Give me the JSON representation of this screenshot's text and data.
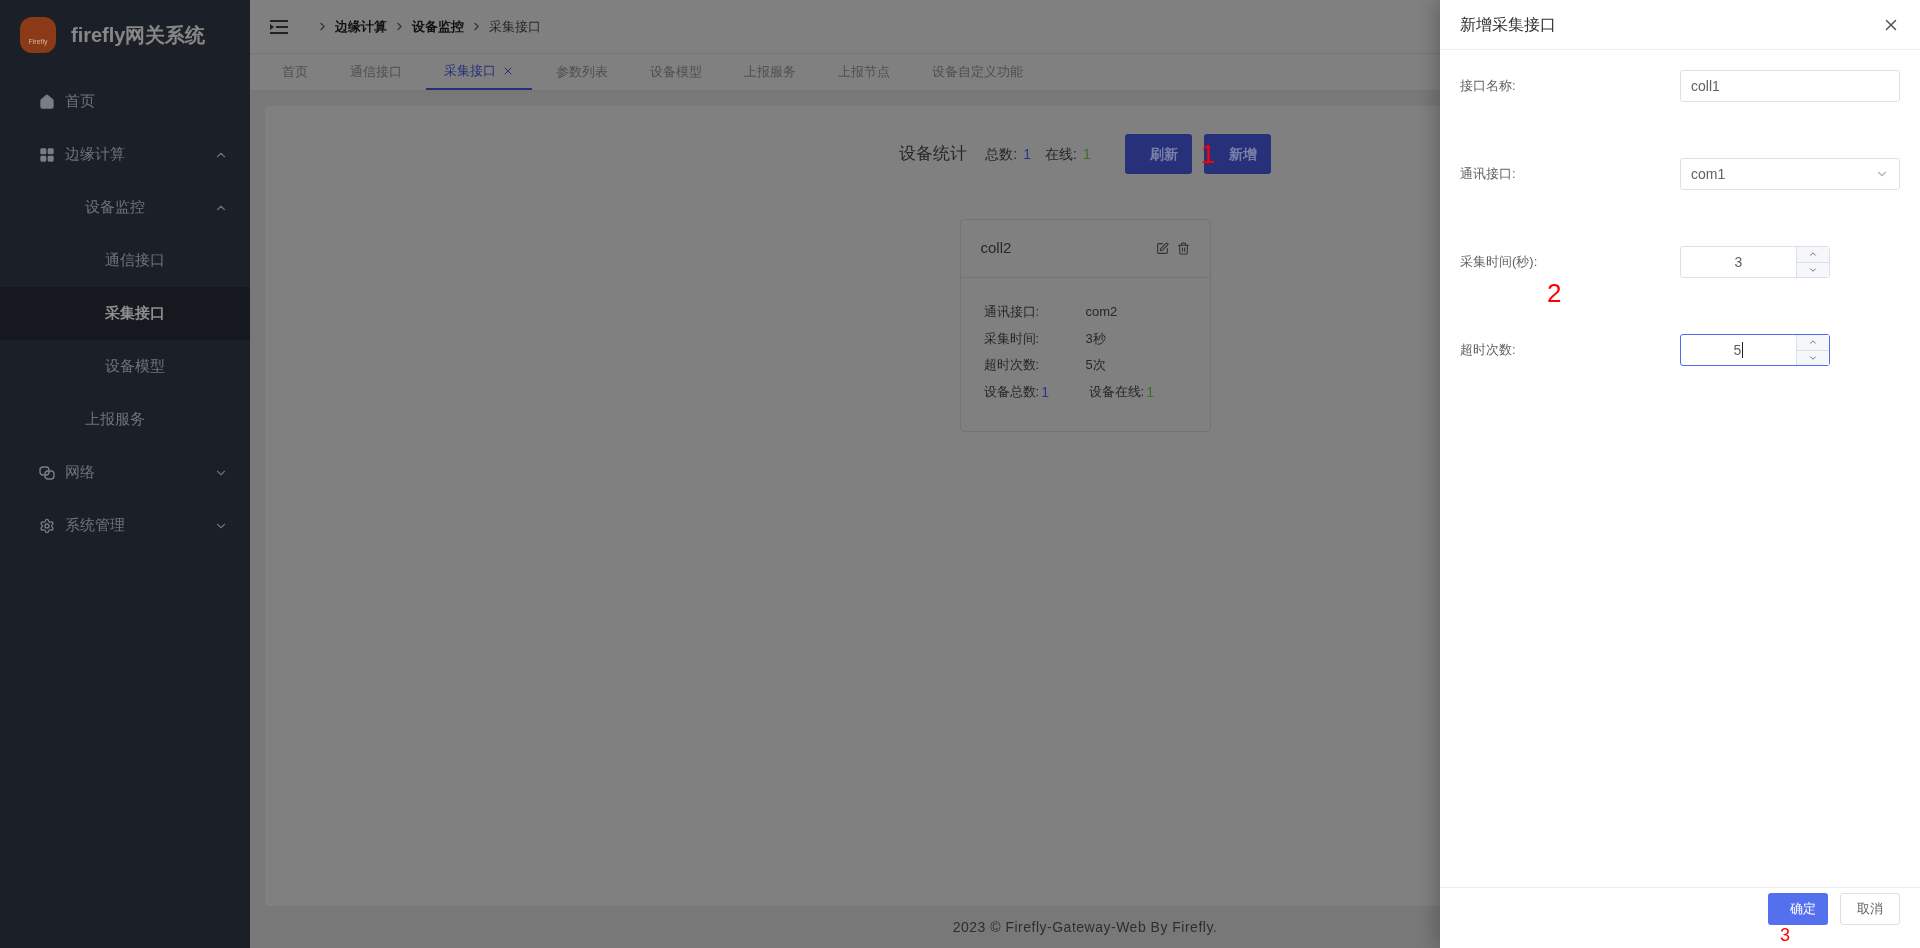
{
  "sidebar": {
    "app_title": "firefly网关系统",
    "logo_text": "Firefly",
    "items": [
      {
        "label": "首页",
        "selected": false
      },
      {
        "label": "边缘计算",
        "expanded": true,
        "children": [
          {
            "label": "设备监控",
            "expanded": true,
            "children": [
              {
                "label": "通信接口",
                "selected": false
              },
              {
                "label": "采集接口",
                "selected": true
              },
              {
                "label": "设备模型",
                "selected": false
              }
            ]
          },
          {
            "label": "上报服务",
            "selected": false
          }
        ]
      },
      {
        "label": "网络",
        "expanded": false
      },
      {
        "label": "系统管理",
        "expanded": false
      }
    ]
  },
  "breadcrumbs": [
    {
      "label": "边缘计算",
      "current": false
    },
    {
      "label": "设备监控",
      "current": false
    },
    {
      "label": "采集接口",
      "current": true
    }
  ],
  "tabs": [
    {
      "label": "首页",
      "selected": false
    },
    {
      "label": "通信接口",
      "selected": false
    },
    {
      "label": "采集接口",
      "selected": true
    },
    {
      "label": "参数列表",
      "selected": false
    },
    {
      "label": "设备模型",
      "selected": false
    },
    {
      "label": "上报服务",
      "selected": false
    },
    {
      "label": "上报节点",
      "selected": false
    },
    {
      "label": "设备自定义功能",
      "selected": false
    }
  ],
  "stats": {
    "title": "设备统计",
    "total_label": "总数:",
    "total": "1",
    "online_label": "在线:",
    "online": "1"
  },
  "toolbar_buttons": [
    "刷新",
    "新增"
  ],
  "card": {
    "name": "coll2",
    "fields": [
      {
        "label": "通讯接口:",
        "value": "com2"
      },
      {
        "label": "采集时间:",
        "value": "3秒"
      },
      {
        "label": "超时次数:",
        "value": "5次"
      }
    ],
    "counts": [
      {
        "kind": "total",
        "label": "设备总数:",
        "value": "1"
      },
      {
        "kind": "online",
        "label": "设备在线:",
        "value": "1"
      }
    ]
  },
  "footer": "2023 © Firefly-Gateway-Web By Firefly.",
  "drawer": {
    "title": "新增采集接口",
    "fields": [
      {
        "kind": "text",
        "label": "接口名称:",
        "value": "coll1",
        "focused": false
      },
      {
        "kind": "select",
        "label": "通讯接口:",
        "value": "com1",
        "focused": false
      },
      {
        "kind": "number",
        "label": "采集时间(秒):",
        "value": "3",
        "focused": false
      },
      {
        "kind": "number",
        "label": "超时次数:",
        "value": "5",
        "focused": true
      }
    ],
    "buttons": [
      {
        "kind": "primary",
        "label": "确定"
      },
      {
        "kind": "default",
        "label": "取消"
      }
    ]
  },
  "annotations": [
    "1",
    "2",
    "3"
  ]
}
